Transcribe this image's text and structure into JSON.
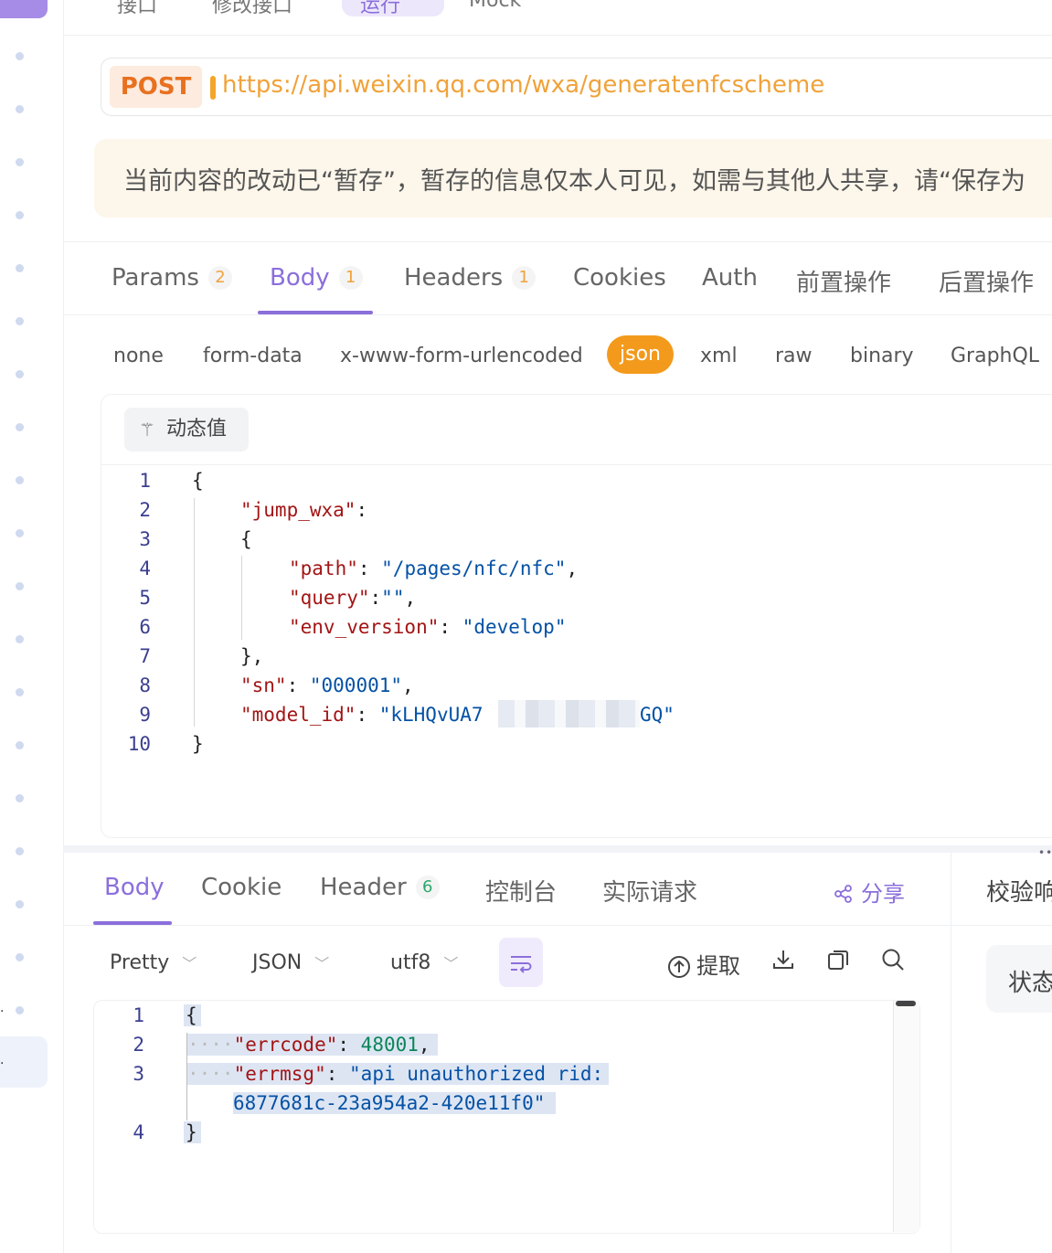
{
  "top_tabs": [
    "接口",
    "修改接口",
    "运行",
    "Mock"
  ],
  "request": {
    "method": "POST",
    "url": "https://api.weixin.qq.com/wxa/generatenfcscheme"
  },
  "notice": "当前内容的改动已“暂存”，暂存的信息仅本人可见，如需与其他人共享，请“保存为",
  "request_tabs": [
    {
      "label": "Params",
      "badge": "2"
    },
    {
      "label": "Body",
      "badge": "1"
    },
    {
      "label": "Headers",
      "badge": "1"
    },
    {
      "label": "Cookies",
      "badge": ""
    },
    {
      "label": "Auth",
      "badge": ""
    },
    {
      "label": "前置操作",
      "badge": ""
    },
    {
      "label": "后置操作",
      "badge": ""
    }
  ],
  "active_request_tab": "Body",
  "body_types": [
    "none",
    "form-data",
    "x-www-form-urlencoded",
    "json",
    "xml",
    "raw",
    "binary",
    "GraphQL"
  ],
  "active_body_type": "json",
  "dynamic_value_label": "动态值",
  "request_body_lines": [
    {
      "n": "1",
      "text": "{"
    },
    {
      "n": "2",
      "key": "\"jump_wxa\"",
      "rest": ":"
    },
    {
      "n": "3",
      "text": "{"
    },
    {
      "n": "4",
      "key": "\"path\"",
      "sep": ": ",
      "value": "\"/pages/nfc/nfc\"",
      "tail": ","
    },
    {
      "n": "5",
      "key": "\"query\"",
      "sep": ":",
      "value": "\"\"",
      "tail": ","
    },
    {
      "n": "6",
      "key": "\"env_version\"",
      "sep": ": ",
      "value": "\"develop\"",
      "tail": ""
    },
    {
      "n": "7",
      "text": "},"
    },
    {
      "n": "8",
      "key": "\"sn\"",
      "sep": ": ",
      "value": "\"000001\"",
      "tail": ","
    },
    {
      "n": "9",
      "key": "\"model_id\"",
      "sep": ": ",
      "value": "\"kLHQvUA7",
      "value_end": "GQ\"",
      "tail": ""
    },
    {
      "n": "10",
      "text": "}"
    }
  ],
  "response_tabs": [
    {
      "label": "Body",
      "badge": ""
    },
    {
      "label": "Cookie",
      "badge": ""
    },
    {
      "label": "Header",
      "badge": "6"
    },
    {
      "label": "控制台",
      "badge": ""
    },
    {
      "label": "实际请求",
      "badge": ""
    }
  ],
  "active_response_tab": "Body",
  "share_label": "分享",
  "verify_label": "校验响",
  "status_label": "状态",
  "response_toolbar": {
    "format": "Pretty",
    "type": "JSON",
    "encoding": "utf8",
    "extract_label": "提取"
  },
  "response_body_lines": [
    {
      "n": "1",
      "text": "{"
    },
    {
      "n": "2",
      "key": "\"errcode\"",
      "sep": ": ",
      "value": "48001",
      "tail": ","
    },
    {
      "n": "3",
      "key": "\"errmsg\"",
      "sep": ": ",
      "value": "\"api unauthorized rid:",
      "tail": ""
    },
    {
      "n": "",
      "value": "6877681c-23a954a2-420e11f0\""
    },
    {
      "n": "4",
      "text": "}"
    }
  ],
  "colors": {
    "accent": "#8b6fdb",
    "method": "#e8711f",
    "url": "#f0a23a",
    "json_pill": "#f39a1c"
  }
}
